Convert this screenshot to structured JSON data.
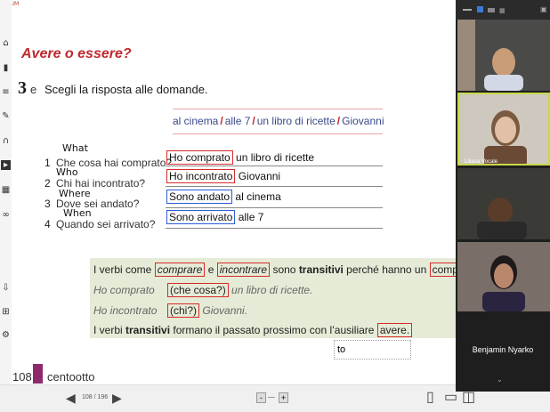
{
  "app": {
    "logo_text": "MoLIM"
  },
  "document": {
    "title": "Avere o essere?",
    "exercise_number": "3",
    "exercise_letter": "e",
    "instruction": "Scegli la risposta alle domande.",
    "word_bank": [
      "al cinema",
      "alle 7",
      "un libro di ricette",
      "Giovanni"
    ],
    "questions": [
      {
        "num": "1",
        "text": "Che cosa hai comprato?",
        "handwritten": "What",
        "answer_boxed": "Ho comprato",
        "answer_rest": "un libro di ricette",
        "box_color": "red"
      },
      {
        "num": "2",
        "text": "Chi hai incontrato?",
        "handwritten": "Who",
        "answer_boxed": "Ho incontrato",
        "answer_rest": "Giovanni",
        "box_color": "red"
      },
      {
        "num": "3",
        "text": "Dove sei andato?",
        "handwritten": "Where",
        "answer_boxed": "Sono andato",
        "answer_rest": "al cinema",
        "box_color": "blue"
      },
      {
        "num": "4",
        "text": "Quando sei arrivato?",
        "handwritten": "When",
        "answer_boxed": "Sono arrivato",
        "answer_rest": "alle 7",
        "box_color": "blue"
      }
    ],
    "rule": {
      "line1": {
        "pre": "I verbi come ",
        "w1": "comprare",
        "mid1": " e ",
        "w2": "incontrare",
        "mid2": " sono ",
        "bold": "transitivi",
        "mid3": " perché hanno un ",
        "boxed": "complemento oggetto"
      },
      "line2": {
        "verb": "Ho comprato",
        "boxed": "(che cosa?)",
        "rest": "un libro di ricette."
      },
      "line3": {
        "verb": "Ho incontrato",
        "boxed": "(chi?)",
        "rest": "Giovanni."
      },
      "line4": {
        "pre": "I verbi ",
        "bold": "transitivi",
        "mid": " formano il passato prossimo con l’ausiliare ",
        "boxed": "avere."
      }
    },
    "text_field": "to",
    "page_number": "108",
    "page_word": "centootto"
  },
  "bottom_bar": {
    "page_indicator": "108 / 196",
    "zoom_minus": "-",
    "zoom_plus": "+"
  },
  "video": {
    "participants": [
      {
        "name": "",
        "shirt": "#d2d8e6",
        "skin": "#c99c78",
        "bg": "#4a4a48"
      },
      {
        "name": "Liliana Vocale",
        "shirt": "#6a4a35",
        "skin": "#e2c0a8",
        "bg": "#cfc8bf"
      },
      {
        "name": "",
        "shirt": "#2a2a2a",
        "skin": "#5a3c2a",
        "bg": "#3a3a36"
      },
      {
        "name": "",
        "shirt": "#2a2440",
        "skin": "#b9876c",
        "bg": "#7a6e68"
      }
    ],
    "speaker_name": "Benjamin Nyarko"
  }
}
